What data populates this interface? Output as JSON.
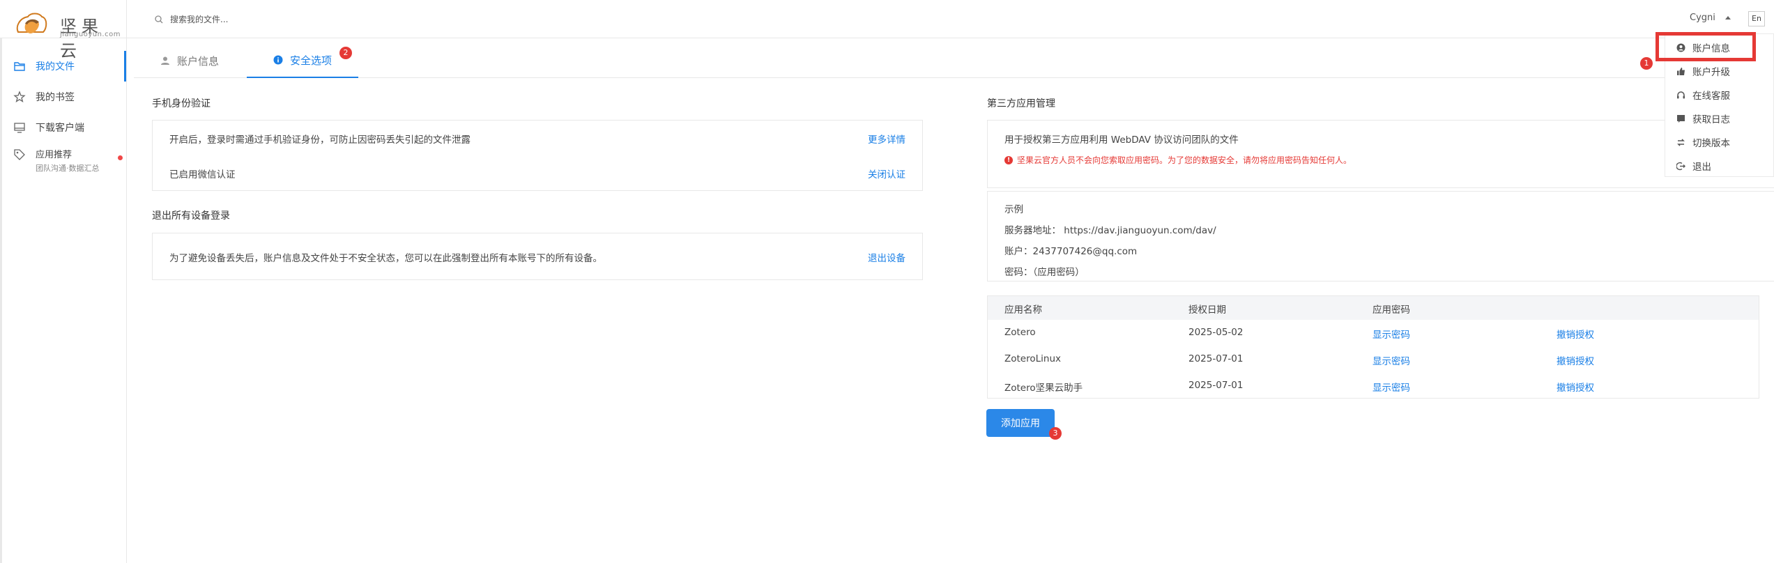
{
  "brand": {
    "name": "坚果云",
    "domain": "jianguoyun.com"
  },
  "search": {
    "placeholder": "搜索我的文件..."
  },
  "user": {
    "name": "Cygni",
    "lang_button": "En"
  },
  "sidebar": {
    "items": [
      {
        "label": "我的文件",
        "icon": "folder-icon",
        "active": true
      },
      {
        "label": "我的书签",
        "icon": "star-icon"
      },
      {
        "label": "下载客户端",
        "icon": "monitor-icon"
      },
      {
        "label": "应用推荐",
        "sub": "团队沟通·数据汇总",
        "icon": "tag-icon",
        "has_dot": true
      }
    ]
  },
  "tabs": [
    {
      "label": "账户信息",
      "icon": "person-icon"
    },
    {
      "label": "安全选项",
      "icon": "info-icon",
      "active": true
    }
  ],
  "badges": {
    "tab": "2",
    "dropdown": "1",
    "add_app": "3"
  },
  "phone_auth": {
    "title": "手机身份验证",
    "desc": "开启后，登录时需通过手机验证身份，可防止因密码丢失引起的文件泄露",
    "more": "更多详情",
    "status": "已启用微信认证",
    "close": "关闭认证"
  },
  "logout_devices": {
    "title": "退出所有设备登录",
    "desc": "为了避免设备丢失后，账户信息及文件处于不安全状态，您可以在此强制登出所有本账号下的所有设备。",
    "action": "退出设备"
  },
  "third_party": {
    "title": "第三方应用管理",
    "desc": "用于授权第三方应用利用 WebDAV 协议访问团队的文件",
    "warning": "坚果云官方人员不会向您索取应用密码。为了您的数据安全，请勿将应用密码告知任何人。",
    "example_title": "示例",
    "server": "服务器地址：  https://dav.jianguoyun.com/dav/",
    "account": "账户：2437707426@qq.com",
    "password": "密码：（应用密码）",
    "columns": [
      "应用名称",
      "授权日期",
      "应用密码"
    ],
    "apps": [
      {
        "name": "Zotero",
        "date": "2025-05-02",
        "show": "显示密码",
        "revoke": "撤销授权"
      },
      {
        "name": "ZoteroLinux",
        "date": "2025-07-01",
        "show": "显示密码",
        "revoke": "撤销授权"
      },
      {
        "name": "Zotero坚果云助手",
        "date": "2025-07-01",
        "show": "显示密码",
        "revoke": "撤销授权"
      }
    ],
    "add_button": "添加应用"
  },
  "dropdown": {
    "items": [
      {
        "label": "账户信息",
        "icon": "account-circle-icon"
      },
      {
        "label": "账户升级",
        "icon": "thumbs-up-icon"
      },
      {
        "label": "在线客服",
        "icon": "headset-icon"
      },
      {
        "label": "获取日志",
        "icon": "log-icon"
      },
      {
        "label": "切换版本",
        "icon": "switch-icon"
      },
      {
        "label": "退出",
        "icon": "logout-icon"
      }
    ]
  },
  "colors": {
    "accent": "#1a7fe6",
    "badge": "#e53935",
    "highlight_box": "#e53935",
    "button": "#2b88e8"
  }
}
